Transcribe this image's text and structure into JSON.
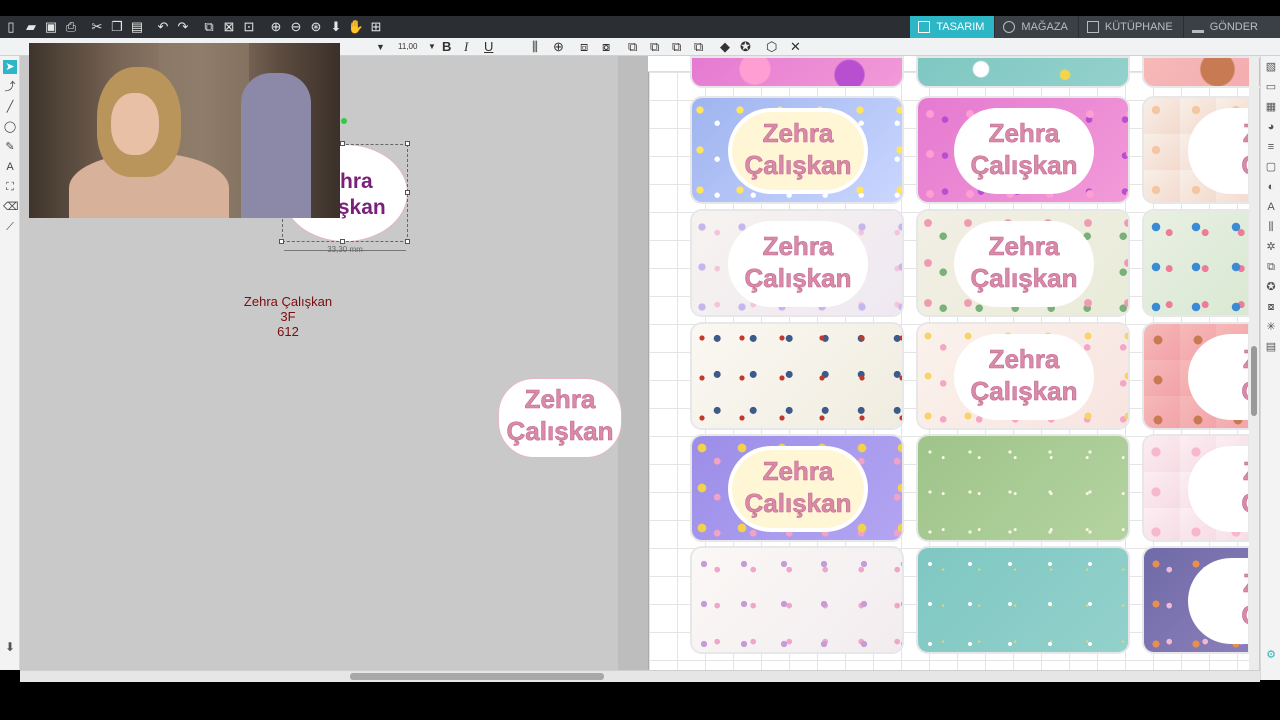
{
  "tabs": [
    {
      "label": "TASARIM",
      "active": true
    },
    {
      "label": "MAĞAZA",
      "active": false
    },
    {
      "label": "KÜTÜPHANE",
      "active": false
    },
    {
      "label": "GÖNDER",
      "active": false
    }
  ],
  "textbar": {
    "font_size": "11,00",
    "bold": "B",
    "italic": "I",
    "underline": "U"
  },
  "canvas": {
    "selected_label": {
      "line1": "hra",
      "line2": "ışkan"
    },
    "dimension": "33,30 mm",
    "info": {
      "name": "Zehra Çalışkan",
      "line2": "3F",
      "line3": "612"
    },
    "free_label": {
      "line1": "Zehra",
      "line2": "Çalışkan"
    }
  },
  "mat_labels": [
    {
      "line1": "Zehra",
      "line2": "Çalışkan"
    },
    {
      "line1": "Zehra",
      "line2": "Çalışkan"
    },
    {
      "line1": "Ze",
      "line2": "Ça"
    },
    {
      "line1": "Zehra",
      "line2": "Çalışkan"
    },
    {
      "line1": "Zehra",
      "line2": "Çalışkan"
    },
    {
      "line1": "Zehra",
      "line2": "Çalışkan"
    },
    {
      "line1": "Ze",
      "line2": "Ça"
    },
    {
      "line1": "Zehra",
      "line2": "Çalışkan"
    },
    {
      "line1": "Ze",
      "line2": "Ça"
    },
    {
      "line1": "Ze",
      "line2": "Ça"
    }
  ],
  "colors": {
    "accent": "#2cb6c6",
    "label_text": "#d88aa8",
    "info_text": "#7a0d0d"
  }
}
